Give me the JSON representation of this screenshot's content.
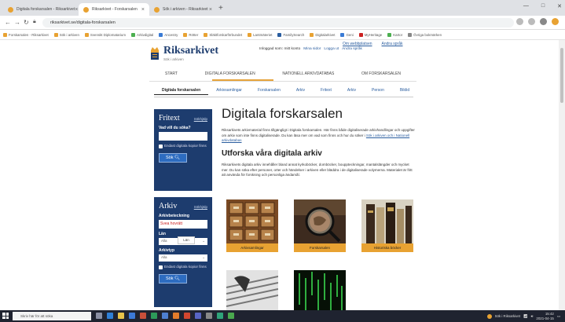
{
  "browser": {
    "tabs": [
      {
        "title": "Digitala forskarsalen - Riksarkivet",
        "active": false,
        "color": "#e8a232"
      },
      {
        "title": "Riksarkivet - Forskarsalen",
        "active": true,
        "color": "#e8a232"
      },
      {
        "title": "Sök i arkiven - Riksarkivet",
        "active": false,
        "color": "#e8a232"
      }
    ],
    "new_tab": "+",
    "url": "riksarkivet.se/digitala-forskarsalen",
    "window_controls": [
      "—",
      "□",
      "✕"
    ],
    "bookmarks": [
      {
        "label": "Forskarsalen - Riksarkivet",
        "color": "#e8a232"
      },
      {
        "label": "Sök i arkiven",
        "color": "#e8a232"
      },
      {
        "label": "Svenskt Diplomatarium",
        "color": "#e8a232"
      },
      {
        "label": "Arkivdigital",
        "color": "#4caf50"
      },
      {
        "label": "Ancestry",
        "color": "#3a7bd5"
      },
      {
        "label": "Rötter",
        "color": "#e8a232"
      },
      {
        "label": "Släktforskarförbundet",
        "color": "#e8a232"
      },
      {
        "label": "Lantmäteriet",
        "color": "#e8a232"
      },
      {
        "label": "FamilySearch",
        "color": "#2a5d9f"
      },
      {
        "label": "Digitalarkivet",
        "color": "#e8a232"
      },
      {
        "label": "Geni",
        "color": "#3a7bd5"
      },
      {
        "label": "MyHeritage",
        "color": "#c22"
      },
      {
        "label": "Kartor",
        "color": "#4caf50"
      },
      {
        "label": "Övriga bokmärken",
        "color": "#888"
      }
    ]
  },
  "site": {
    "logo": "Riksarkivet",
    "logo_sub": "Sök i arkiven",
    "top_links": [
      "Om webbplatsen",
      "Andra språk"
    ],
    "login_text": "Inloggad som: mitt konto",
    "login_links": [
      "Mina sidor",
      "Logga ut",
      "Andra språk"
    ],
    "main_nav": [
      "Start",
      "Digitala forskarsalen",
      "Nationell arkivdatabas",
      "Om forskarsalen"
    ],
    "sub_nav": [
      "Digitala forskarsalen",
      "Arkivsamlingar",
      "Forskarsalen",
      "Arkiv",
      "Fritext",
      "Arkiv",
      "Person",
      "Bildid"
    ]
  },
  "sidebar": {
    "fritext": {
      "title": "Fritext",
      "link": "Sökhjälp",
      "label": "Vad vill du söka?",
      "value": "",
      "checkbox": "Endast digitala kopior finns",
      "button": "Sök"
    },
    "arkiv": {
      "title": "Arkiv",
      "link": "Sökhjälp",
      "label1": "Arkivbeteckning",
      "value1": "Svea hovrätt",
      "label2": "Län",
      "select2": "Alla",
      "label3": "Arkivtyp",
      "select3": "Alla",
      "checkbox": "Endast digitala kopior finns",
      "button": "Sök",
      "tooltip": "Län"
    }
  },
  "main": {
    "title": "Digitala forskarsalen",
    "intro": "Riksarkivets arkivmaterial finns tillgängligt i Digitala forskarsalen. Här finns både digitaliserade arkivhandlingar och uppgifter om arkiv som inte finns digitaliserade. Du kan läsa mer om vad som finns och hur du söker i",
    "intro_link": "Sök i arkiven och i Nationell arkivdatabas",
    "subtitle": "Utforska våra digitala arkiv",
    "body": "Riksarkivets digitala arkiv innehåller bland annat kyrkoböcker, domböcker, bouppteckningar, mantalslängder och mycket mer. Du kan söka efter personer, orter och händelser i arkiven eller bläddra i de digitaliserade volymerna. Materialet är fritt att använda för forskning och personliga ändamål.",
    "cards": [
      {
        "label": "Arkivsamlingar"
      },
      {
        "label": "Forskarsalen"
      },
      {
        "label": "Historiska böcker"
      },
      {
        "label": ""
      },
      {
        "label": ""
      },
      {
        "label": ""
      }
    ]
  },
  "taskbar": {
    "search": "Skriv här för att söka",
    "tray_text": "Sök i Riksarkivet",
    "time": "15:42",
    "date": "2021-04-15"
  }
}
